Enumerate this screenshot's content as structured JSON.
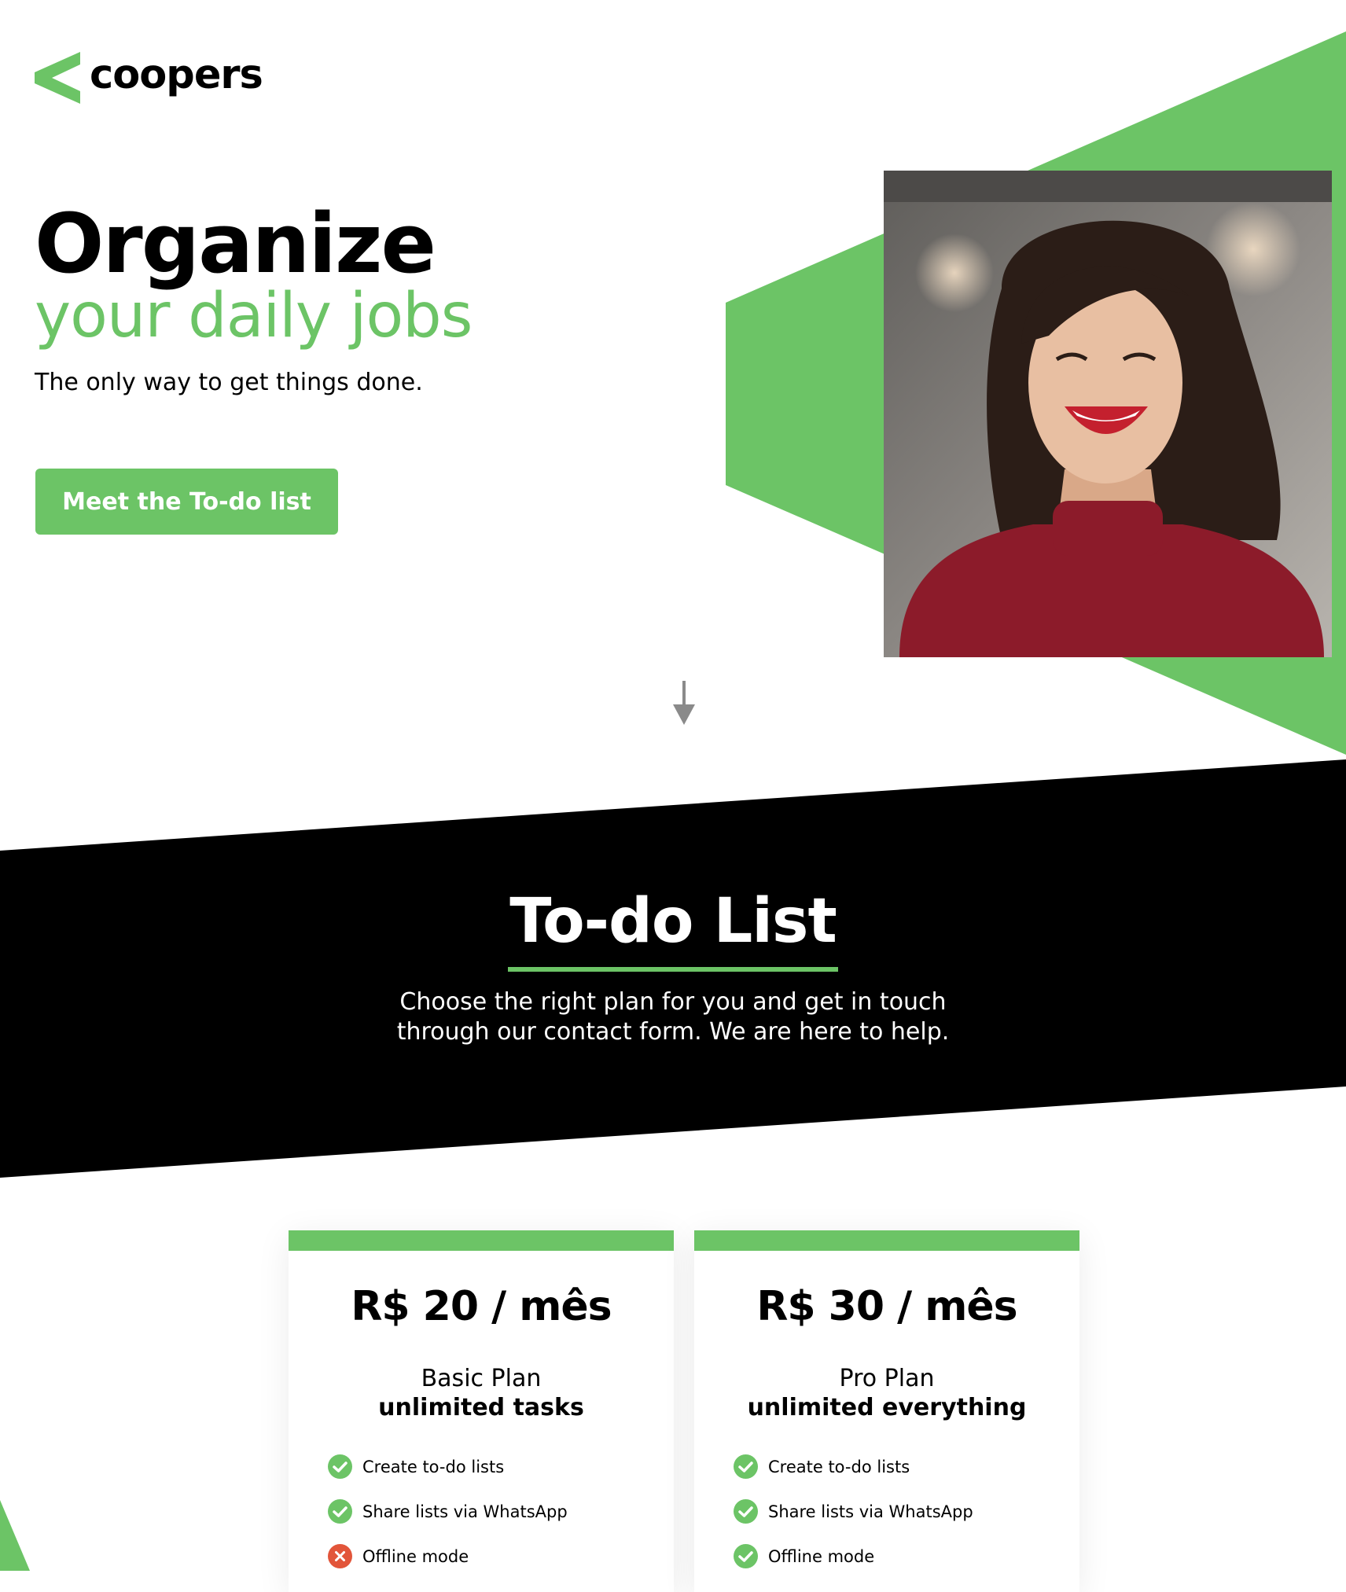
{
  "brand": {
    "name": "coopers",
    "accent": "#6cc466"
  },
  "hero": {
    "title": "Organize",
    "subtitle": "your daily jobs",
    "tagline": "The only way to get things done.",
    "cta_label": "Meet the To-do list"
  },
  "todo": {
    "title": "To-do List",
    "desc_line1": "Choose the right plan for you and get in touch",
    "desc_line2": "through our contact form. We are here to help."
  },
  "plans": [
    {
      "price": "R$ 20 / mês",
      "name": "Basic Plan",
      "tagline": "unlimited tasks",
      "features": [
        {
          "label": "Create to-do lists",
          "included": true
        },
        {
          "label": "Share lists via WhatsApp",
          "included": true
        },
        {
          "label": "Offline mode",
          "included": false
        }
      ]
    },
    {
      "price": "R$ 30 / mês",
      "name": "Pro Plan",
      "tagline": "unlimited everything",
      "features": [
        {
          "label": "Create to-do lists",
          "included": true
        },
        {
          "label": "Share lists via WhatsApp",
          "included": true
        },
        {
          "label": "Offline mode",
          "included": true
        }
      ]
    }
  ],
  "colors": {
    "accent": "#6cc466",
    "dark": "#000000",
    "excluded": "#e2553a",
    "sweater": "#8c1b2a"
  },
  "icons": {
    "check": "check-circle-icon",
    "cross": "x-circle-icon",
    "arrow": "arrow-down-icon"
  }
}
